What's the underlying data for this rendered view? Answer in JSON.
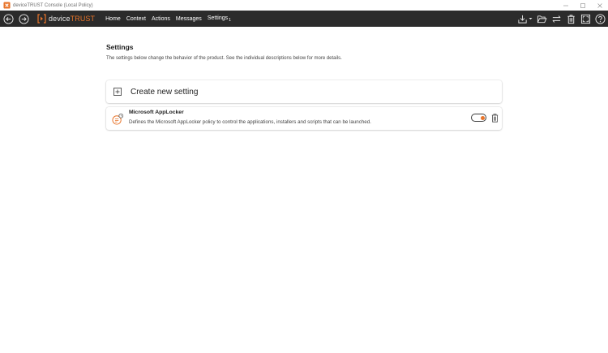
{
  "window": {
    "title": "deviceTRUST Console (Local Policy)"
  },
  "toolbar": {
    "brand_primary": "device",
    "brand_accent": "TRUST",
    "menu": [
      {
        "label": "Home"
      },
      {
        "label": "Context"
      },
      {
        "label": "Actions"
      },
      {
        "label": "Messages"
      },
      {
        "label": "Settings",
        "badge": "1"
      }
    ]
  },
  "page": {
    "title": "Settings",
    "description": "The settings below change the behavior of the product. See the individual descriptions below for more details.",
    "create_label": "Create new setting",
    "settings": [
      {
        "title": "Microsoft AppLocker",
        "description": "Defines the Microsoft AppLocker policy to control the applications, installers and scripts that can be launched.",
        "enabled": true
      }
    ]
  },
  "colors": {
    "accent": "#e8742a",
    "toolbar_bg": "#2b2b2b"
  },
  "icons": {
    "toolbar": [
      "download-icon",
      "open-folder-icon",
      "compare-icon",
      "delete-icon",
      "fullscreen-icon",
      "help-icon"
    ]
  }
}
